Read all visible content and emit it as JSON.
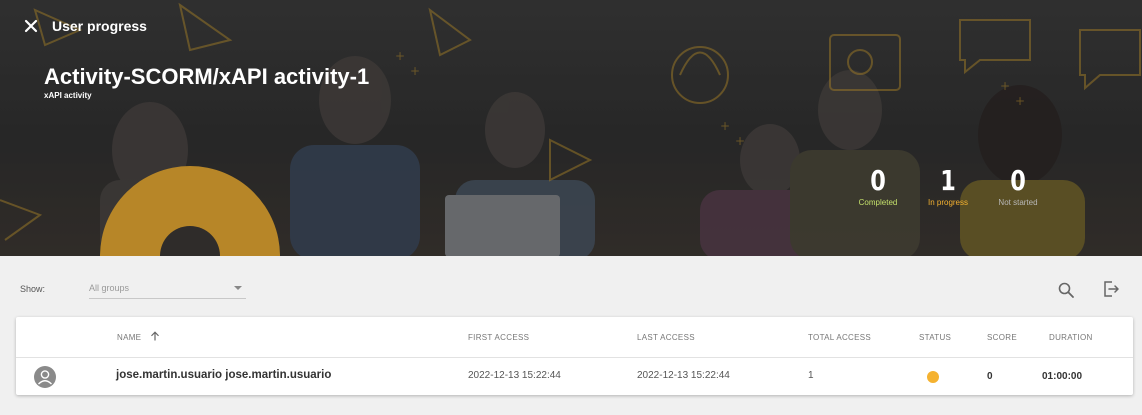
{
  "header": {
    "title": "User progress",
    "close_icon": "close-icon",
    "activity_title": "Activity-SCORM/xAPI activity-1",
    "activity_type": "xAPI activity"
  },
  "stats": {
    "completed": {
      "value": "0",
      "label": "Completed",
      "color": "#c4e06b"
    },
    "in_progress": {
      "value": "1",
      "label": "In progress",
      "color": "#f5b230"
    },
    "not_started": {
      "value": "0",
      "label": "Not started",
      "color": "#b8b8b8"
    }
  },
  "filter": {
    "show_label": "Show:",
    "group_value": "All groups"
  },
  "toolbar": {
    "search_icon": "search-icon",
    "export_icon": "export-icon"
  },
  "table": {
    "columns": {
      "name": "NAME",
      "first_access": "FIRST ACCESS",
      "last_access": "LAST ACCESS",
      "total_access": "TOTAL ACCESS",
      "status": "STATUS",
      "score": "SCORE",
      "duration": "DURATION"
    },
    "sort_icon": "arrow-up-icon",
    "rows": [
      {
        "name": "jose.martin.usuario jose.martin.usuario",
        "first_access": "2022-12-13 15:22:44",
        "last_access": "2022-12-13 15:22:44",
        "total_access": "1",
        "status_color": "#f5b230",
        "score": "0",
        "duration": "01:00:00"
      }
    ]
  },
  "colors": {
    "accent": "#f5b230",
    "hero_bg": "#333333"
  }
}
